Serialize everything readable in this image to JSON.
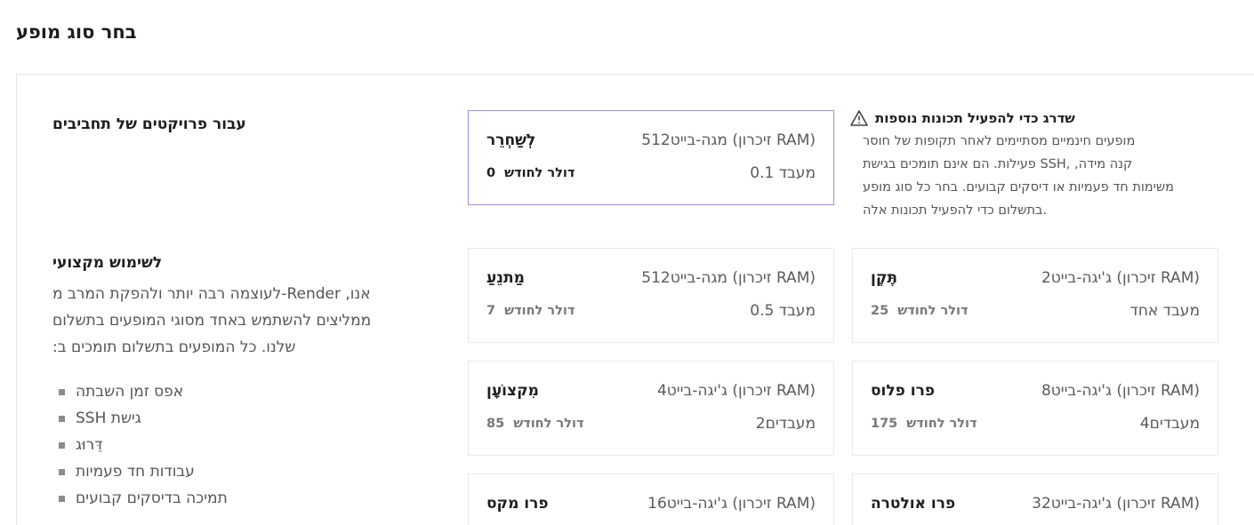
{
  "page": {
    "title": "בחר סוג מופע"
  },
  "hobby": {
    "title": "עבור פרויקטים של תחביבים"
  },
  "professional": {
    "title": "לשימוש מקצועי",
    "description": "אנו ממליצים להשתמש באחד מסוגי המופעים בתשלום שלנו. כל המופעים בתשלום תומכים ב-Render-לעוצמה רבה יותר ולהפקת המרב מ:",
    "desc_lines": [
      "אנו, Render-לעוצמה רבה יותר ולהפקת המרב מ",
      "ממליצים להשתמש באחד מסוגי המופעים בתשלום",
      "שלנו. כל המופעים בתשלום תומכים ב:"
    ],
    "features": [
      "אפס זמן השבתה",
      "SSH גישת",
      "דֵּרוּג",
      "עבודות חד פעמיות",
      "תמיכה בדיסקים קבועים"
    ]
  },
  "upgrade_notice": {
    "icon": "warning-triangle-icon",
    "title": "שדרג כדי להפעיל תכונות נוספות",
    "lines": [
      "מופעים חינמיים מסתיימים לאחר תקופות של חוסר",
      "קנה מידה, ,SSH פעילות. הם אינם תומכים בגישת",
      "משימות חד פעמיות או דיסקים קבועים. בחר כל סוג מופע",
      ".בתשלום כדי להפעיל תכונות אלה"
    ]
  },
  "instances": [
    {
      "id": "free",
      "name": "לְשַׁחְרֵר",
      "ram": "(RAM) זיכרון) מגה-בייט512",
      "ram_display": "(RAM זיכרון) מגה-בייט512",
      "cpu": "מעבד 0.1",
      "price_label": "דולר לחודש",
      "price": "0",
      "selected": true
    },
    {
      "id": "starter",
      "name": "מַתנֵעַ",
      "ram_display": "(RAM זיכרון) מגה-בייט512",
      "cpu": "מעבד 0.5",
      "price_label": "דולר לחודש",
      "price": "7",
      "selected": false
    },
    {
      "id": "standard",
      "name": "תֶּקֶן",
      "ram_display": "(RAM זיכרון) ג'יגה-בייט2",
      "cpu": "מעבד אחד",
      "price_label": "דולר לחודש",
      "price": "25",
      "selected": false
    },
    {
      "id": "pro",
      "name": "מִקצוֹעָן",
      "ram_display": "(RAM זיכרון) ג'יגה-בייט4",
      "cpu": "מעבדים2",
      "price_label": "דולר לחודש",
      "price": "85",
      "selected": false
    },
    {
      "id": "pro-plus",
      "name": "פרו פלוס",
      "ram_display": "(RAM זיכרון) ג'יגה-בייט8",
      "cpu": "מעבדים4",
      "price_label": "דולר לחודש",
      "price": "175",
      "selected": false
    },
    {
      "id": "pro-max",
      "name": "פרו מקס",
      "ram_display": "(RAM זיכרון) ג'יגה-בייט16",
      "cpu": "",
      "price_label": "",
      "price": "",
      "selected": false
    },
    {
      "id": "pro-ultra",
      "name": "פרו אולטרה",
      "ram_display": "(RAM זיכרון) ג'יגה-בייט32",
      "cpu": "",
      "price_label": "",
      "price": "",
      "selected": false
    }
  ],
  "colors": {
    "selected_border": "#a98bd9",
    "card_border": "#e8e8e8",
    "text_muted": "#5a5a5a"
  }
}
